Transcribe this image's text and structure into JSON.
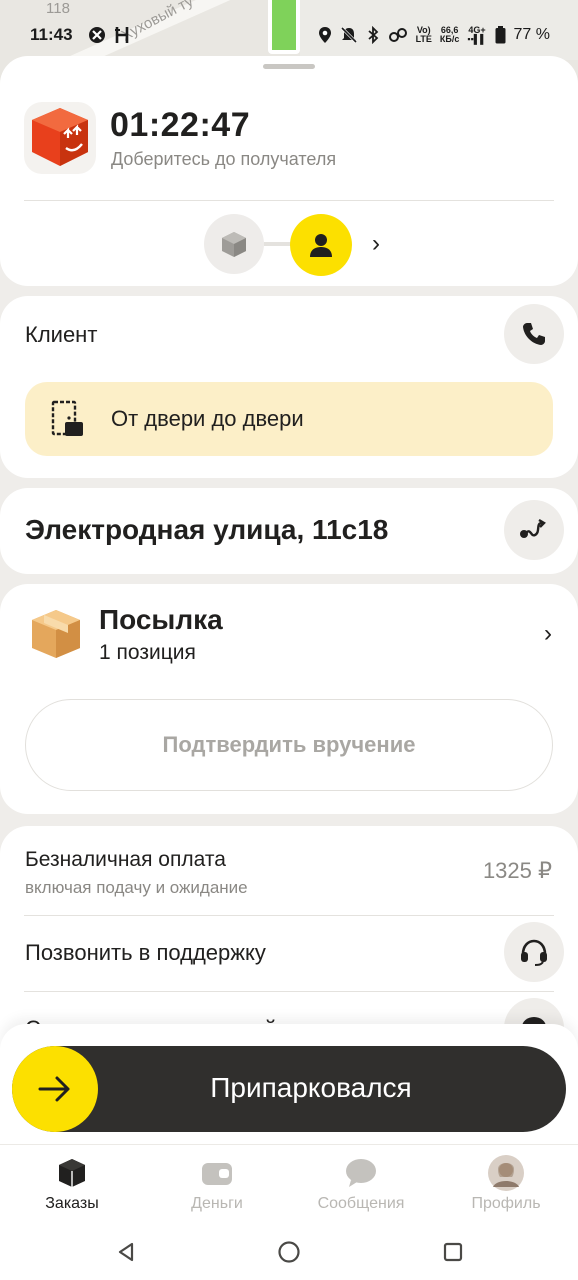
{
  "status_bar": {
    "time": "11:43",
    "battery": "77 %",
    "network_speed_value": "66,6",
    "network_speed_unit": "КБ/с",
    "network_type": "4G+",
    "volte": "VoLTE"
  },
  "map": {
    "street_label": "Хуховый ту",
    "building_number": "118"
  },
  "order": {
    "timer": "01:22:47",
    "subtitle": "Доберитесь до получателя"
  },
  "client": {
    "title": "Клиент",
    "delivery_type": "От двери до двери"
  },
  "address": {
    "text": "Электродная улица, 11с18"
  },
  "parcel": {
    "title": "Посылка",
    "count": "1 позиция",
    "confirm_button": "Подтвердить вручение"
  },
  "payment": {
    "title": "Безналичная оплата",
    "subtitle": "включая подачу и ожидание",
    "amount": "1325 ₽"
  },
  "support": {
    "call_label": "Позвонить в поддержку",
    "contact_label": "Связаться с поддержкой"
  },
  "action": {
    "slider_label": "Припарковался"
  },
  "tabs": [
    {
      "label": "Заказы",
      "icon": "orders-icon",
      "active": true
    },
    {
      "label": "Деньги",
      "icon": "wallet-icon",
      "active": false
    },
    {
      "label": "Сообщения",
      "icon": "chat-icon",
      "active": false
    },
    {
      "label": "Профиль",
      "icon": "avatar",
      "active": false
    }
  ],
  "colors": {
    "accent_yellow": "#fce000",
    "door_to_door_bg": "#fcefc8",
    "parcel_red": "#e8401c",
    "slider_bg": "#302f2d"
  }
}
